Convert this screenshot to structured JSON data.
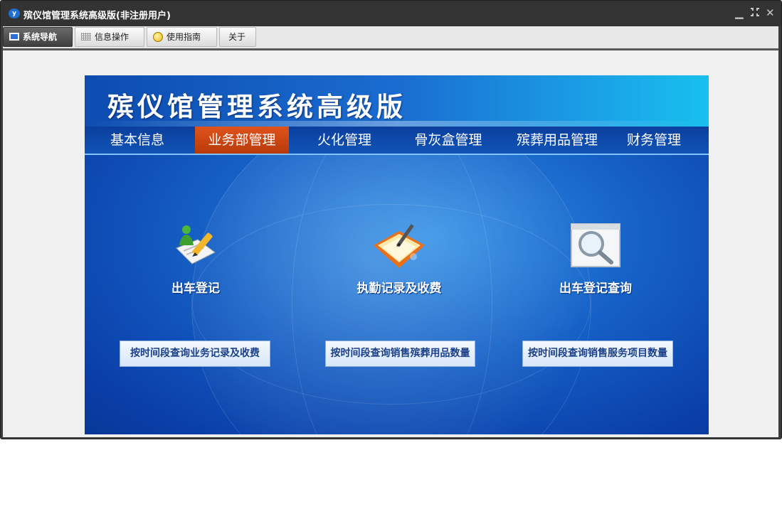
{
  "window": {
    "title": "殡仪馆管理系统高级版(非注册用户)",
    "controls": {
      "minimize": "▁",
      "restore": "⁞",
      "close": "✕"
    }
  },
  "toolbar": {
    "tabs": [
      {
        "label": "系统导航",
        "icon": "monitor-icon",
        "active": true
      },
      {
        "label": "信息操作",
        "icon": "grid-icon",
        "active": false
      },
      {
        "label": "使用指南",
        "icon": "help-icon",
        "active": false
      },
      {
        "label": "关于",
        "icon": "",
        "active": false
      }
    ]
  },
  "banner": {
    "title": "殡仪馆管理系统高级版",
    "nav": [
      "基本信息",
      "业务部管理",
      "火化管理",
      "骨灰盒管理",
      "殡葬用品管理",
      "财务管理"
    ],
    "active_nav": "业务部管理",
    "features": [
      {
        "label": "出车登记",
        "icon": "register-pen-icon"
      },
      {
        "label": "执勤记录及收费",
        "icon": "folder-pen-icon"
      },
      {
        "label": "出车登记查询",
        "icon": "magnifier-icon"
      }
    ],
    "query_buttons": [
      "按时间段查询业务记录及收费",
      "按时间段查询销售殡葬用品数量",
      "按时间段查询销售服务项目数量"
    ]
  },
  "colors": {
    "accent_active_nav": "#c9440f",
    "banner_blue": "#1560c6",
    "title_bar": "#333333"
  }
}
